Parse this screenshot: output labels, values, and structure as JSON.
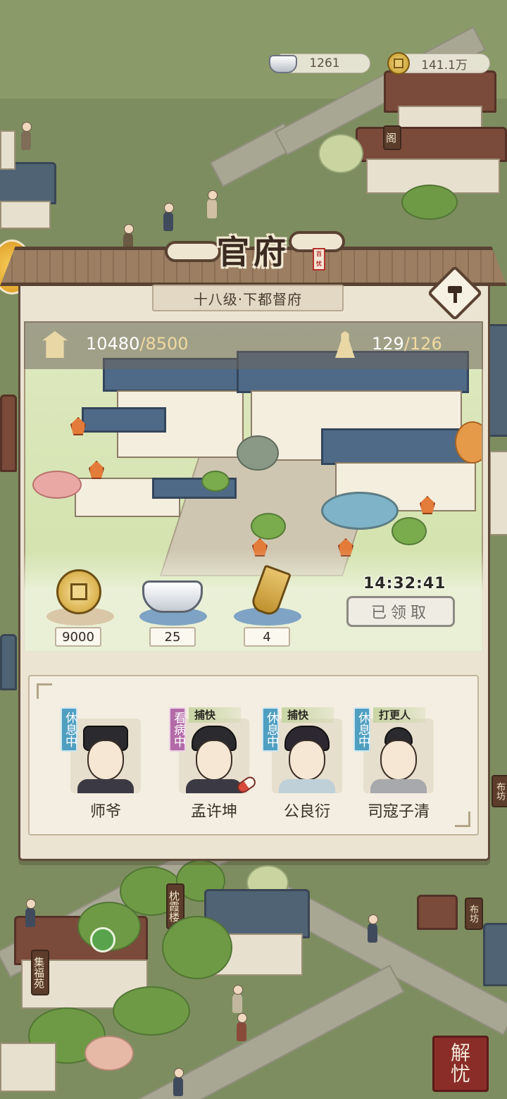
{
  "resources": {
    "silver": {
      "icon": "silver-ingot-icon",
      "value": "1261"
    },
    "coins": {
      "icon": "copper-coin-icon",
      "value": "141.1万"
    }
  },
  "map_labels": {
    "pavilion": "阁",
    "cloth_shop_right": "布坊",
    "cloth_shop_lower": "布坊",
    "zhenxia_tower": "枕霞楼",
    "jifu_garden": "集福苑"
  },
  "panel": {
    "title": "官府",
    "seal_text": "百忧",
    "level_text": "十八级·下都督府",
    "upgrade_icon": "hammer-icon",
    "stats": {
      "prosperity": {
        "icon": "hall-icon",
        "current": "10480",
        "cap": "/8500"
      },
      "population": {
        "icon": "person-icon",
        "current": "129",
        "cap": "/126"
      }
    },
    "rewards": [
      {
        "icon": "copper-coin-icon",
        "count": "9000"
      },
      {
        "icon": "silver-ingot-icon",
        "count": "25"
      },
      {
        "icon": "gold-token-icon",
        "count": "4"
      }
    ],
    "timer": "14:32:41",
    "claim_button": "已领取",
    "staff": [
      {
        "name": "师爷",
        "status": "休息中",
        "role": ""
      },
      {
        "name": "孟许坤",
        "status": "看病中",
        "role": "捕快"
      },
      {
        "name": "公良衍",
        "status": "休息中",
        "role": "捕快"
      },
      {
        "name": "司寇子清",
        "status": "休息中",
        "role": "打更人"
      }
    ]
  },
  "corner_stamp": {
    "line1": "解",
    "line2": "忧"
  },
  "colors": {
    "rest_status": "#4f9fc1",
    "sick_status": "#b36ba8",
    "panel_bg": "#ece4d3",
    "frame_brown": "#5f4a3a"
  }
}
